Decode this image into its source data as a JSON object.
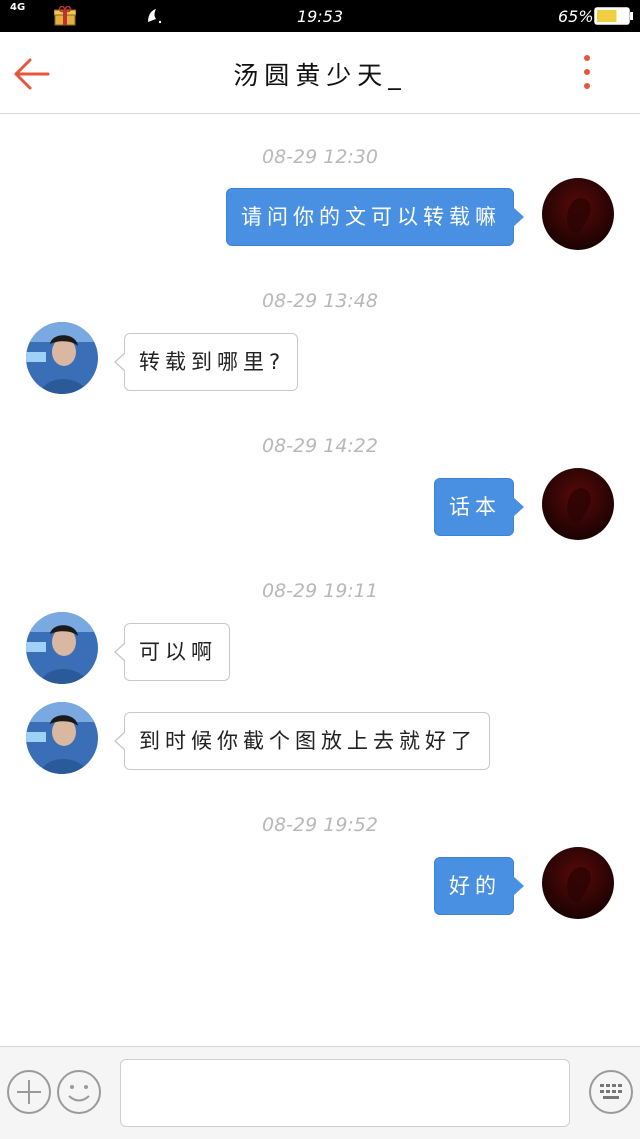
{
  "status_bar": {
    "network": "4G",
    "time": "19:53",
    "battery_percent": "65%",
    "battery_level": 0.65,
    "icons": [
      "gift-icon",
      "bird-icon",
      "battery-icon"
    ]
  },
  "header": {
    "title": "汤圆黄少天_",
    "back_icon": "arrow-left-icon",
    "more_icon": "more-vertical-icon",
    "accent_color": "#e8553b"
  },
  "messages": [
    {
      "timestamp": "08-29 12:30",
      "side": "out",
      "text": "请问你的文可以转载嘛"
    },
    {
      "timestamp": "08-29 13:48",
      "side": "in",
      "text": "转载到哪里?"
    },
    {
      "timestamp": "08-29 14:22",
      "side": "out",
      "text": "话本"
    },
    {
      "timestamp": "08-29 19:11",
      "side": "in",
      "text": "可以啊"
    },
    {
      "side": "in",
      "text": "到时候你截个图放上去就好了"
    },
    {
      "timestamp": "08-29 19:52",
      "side": "out",
      "text": "好的"
    }
  ],
  "colors": {
    "outgoing_bubble": "#4a90e2",
    "incoming_bubble": "#ffffff",
    "timestamp_text": "#b8b8b8"
  },
  "input_bar": {
    "message_value": "",
    "message_placeholder": "",
    "icons": [
      "plus-icon",
      "emoji-icon",
      "keyboard-icon"
    ]
  }
}
